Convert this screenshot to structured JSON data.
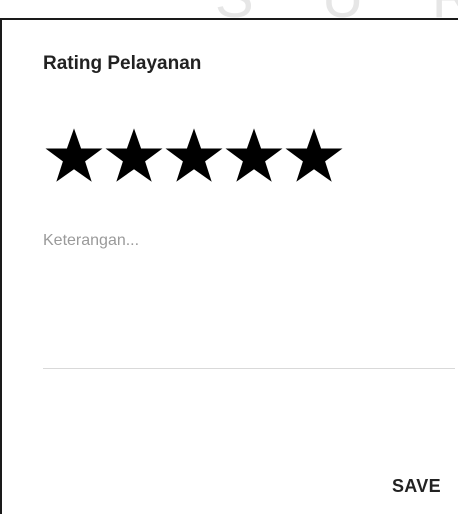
{
  "watermark": {
    "text": "S U R A B"
  },
  "dialog": {
    "title": "Rating Pelayanan",
    "rating": {
      "value": 5,
      "max": 5,
      "star_color": "#000000",
      "star_icon": "star-icon"
    },
    "note": {
      "value": "",
      "placeholder": "Keterangan..."
    },
    "actions": {
      "save_label": "SAVE"
    }
  }
}
